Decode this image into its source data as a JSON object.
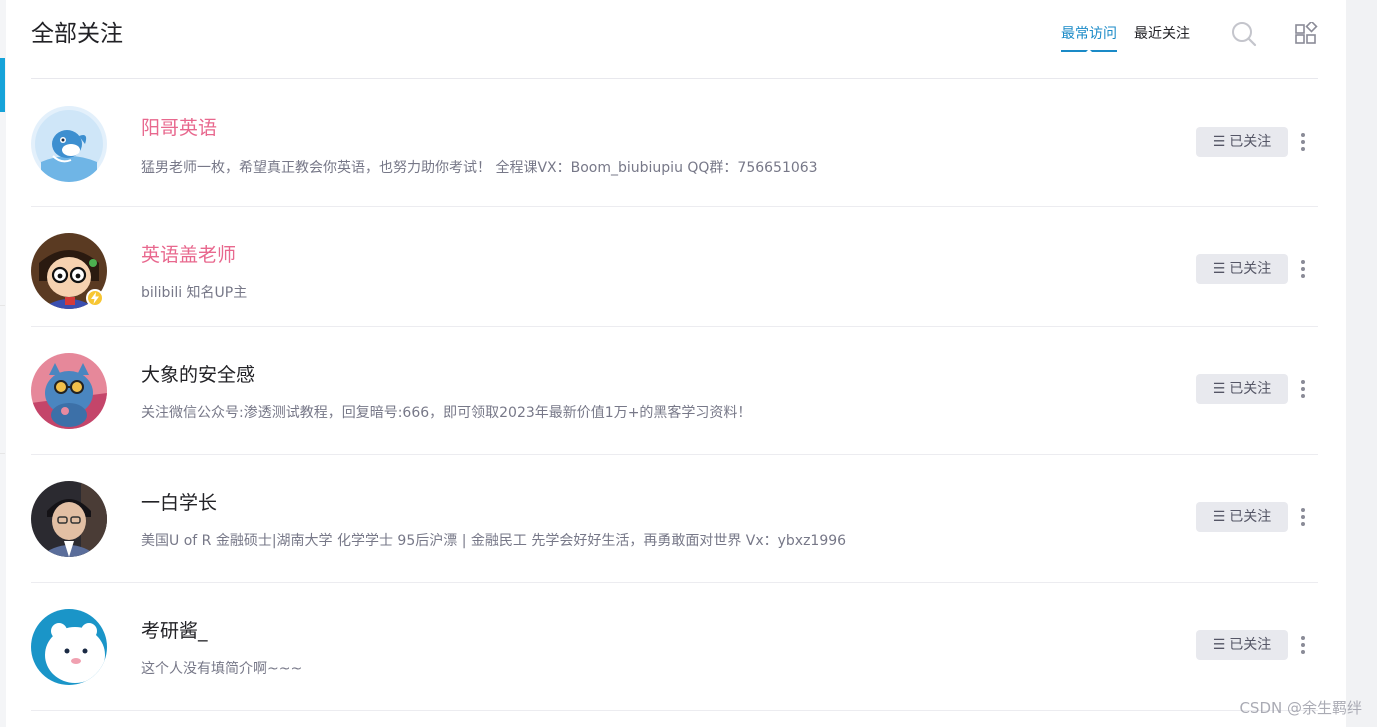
{
  "header": {
    "title": "全部关注",
    "tabs": [
      {
        "label": "最常访问",
        "active": true
      },
      {
        "label": "最近关注",
        "active": false
      }
    ],
    "search_icon": "search-icon",
    "grid_icon": "grid-view-icon"
  },
  "follows": [
    {
      "name": "阳哥英语",
      "description": "猛男老师一枚，希望真正教会你英语，也努力助你考试！ 全程课VX：Boom_biubiupiu QQ群：756651063",
      "button_label": "已关注",
      "name_color": "#e8688e",
      "avatar_icon": "dolphin-avatar"
    },
    {
      "name": "英语盖老师",
      "description": "bilibili 知名UP主",
      "button_label": "已关注",
      "name_color": "#e8688e",
      "avatar_icon": "cartoon-glasses-avatar",
      "verified_badge": "lightning-badge-icon"
    },
    {
      "name": "大象的安全感",
      "description": "关注微信公众号:渗透测试教程，回复暗号:666，即可领取2023年最新价值1万+的黑客学习资料！",
      "button_label": "已关注",
      "name_color": "#222226",
      "avatar_icon": "blue-cat-sunglasses-avatar"
    },
    {
      "name": "一白学长",
      "description": "美国U of R 金融硕士|湖南大学 化学学士 95后沪漂 | 金融民工 先学会好好生活，再勇敢面对世界 Vx：ybxz1996",
      "button_label": "已关注",
      "name_color": "#222226",
      "avatar_icon": "person-photo-avatar"
    },
    {
      "name": "考研酱_",
      "description": "这个人没有填简介啊~~~",
      "button_label": "已关注",
      "name_color": "#222226",
      "avatar_icon": "blue-bear-avatar"
    }
  ],
  "watermark": "CSDN @余生羁绊",
  "colors": {
    "accent": "#1a8ac7",
    "pink_name": "#e8688e",
    "button_bg": "#e8e9ee"
  }
}
